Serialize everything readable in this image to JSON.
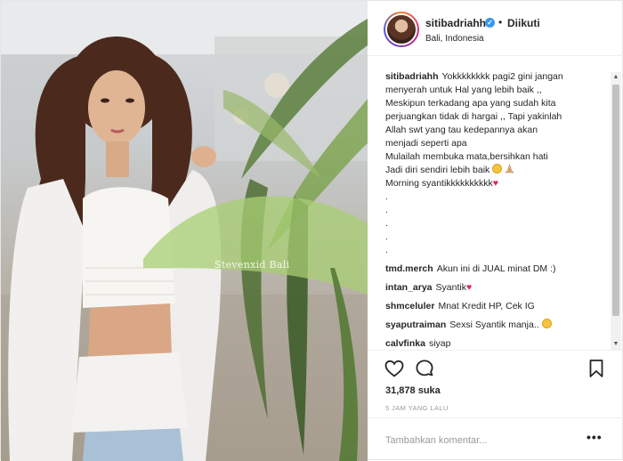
{
  "photo": {
    "watermark": "Stevenxid Bali"
  },
  "header": {
    "username": "sitibadriahh",
    "verified_mark": "✓",
    "separator": "•",
    "follow_status": "Diikuti",
    "location": "Bali, Indonesia"
  },
  "caption": {
    "username": "sitibadriahh",
    "lines": [
      "Yokkkkkkkk pagi2 gini jangan",
      "menyerah untuk Hal yang lebih baik ,,",
      "Meskipun terkadang apa yang sudah kita",
      "perjuangkan tidak di hargai ,, Tapi yakinlah",
      "Allah swt yang tau kedepannya akan",
      "menjadi seperti apa",
      "Mulailah membuka mata,bersihkan hati",
      "Jadi diri sendiri lebih baik",
      "Morning syantikkkkkkkkkk"
    ],
    "dots": [
      ".",
      ".",
      ".",
      ".",
      "."
    ]
  },
  "comments": [
    {
      "username": "tmd.merch",
      "text": "Akun ini di JUAL minat DM :)"
    },
    {
      "username": "intan_arya",
      "text": "Syantik"
    },
    {
      "username": "shmceluler",
      "text": "Mnat Kredit HP, Cek IG"
    },
    {
      "username": "syaputraiman",
      "text": "Sexsi Syantik manja.."
    },
    {
      "username": "calvfinka",
      "text": "siyap"
    }
  ],
  "scrollbar": {
    "up": "▲",
    "down": "▼"
  },
  "icons": {
    "like": "heart-icon",
    "comment": "comment-icon",
    "save": "bookmark-icon",
    "more": "more-options-icon"
  },
  "likes": "31,878 suka",
  "timestamp": "5 JAM YANG LALU",
  "add_comment": {
    "placeholder": "Tambahkan komentar...",
    "more_label": "•••"
  },
  "colors": {
    "verified": "#3897f0",
    "heart_emoji": "#e0245e",
    "text": "#262626",
    "muted": "#999999"
  }
}
